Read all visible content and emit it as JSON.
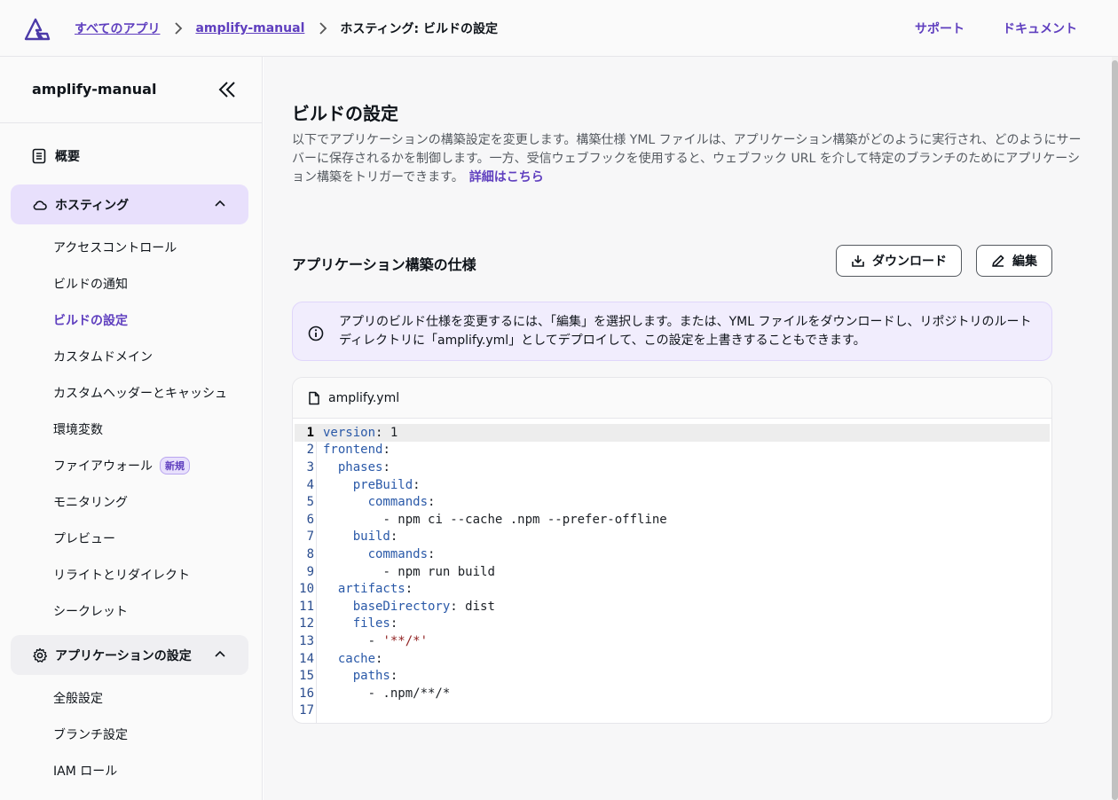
{
  "breadcrumb": {
    "all_apps": "すべてのアプリ",
    "app": "amplify-manual",
    "current": "ホスティング: ビルドの設定"
  },
  "toplinks": {
    "support": "サポート",
    "docs": "ドキュメント"
  },
  "sidebar": {
    "app_name": "amplify-manual",
    "overview": "概要",
    "hosting": {
      "label": "ホスティング",
      "items": [
        "アクセスコントロール",
        "ビルドの通知",
        "ビルドの設定",
        "カスタムドメイン",
        "カスタムヘッダーとキャッシュ",
        "環境変数",
        "ファイアウォール",
        "モニタリング",
        "プレビュー",
        "リライトとリダイレクト",
        "シークレット"
      ],
      "firewall_badge": "新規"
    },
    "app_settings": {
      "label": "アプリケーションの設定",
      "items": [
        "全般設定",
        "ブランチ設定",
        "IAM ロール"
      ]
    }
  },
  "main": {
    "title": "ビルドの設定",
    "description": "以下でアプリケーションの構築設定を変更します。構築仕様 YML ファイルは、アプリケーション構築がどのように実行され、どのようにサーバーに保存されるかを制御します。一方、受信ウェブフックを使用すると、ウェブフック URL を介して特定のブランチのためにアプリケーション構築をトリガーできます。",
    "learn_more": "詳細はこちら",
    "spec_title": "アプリケーション構築の仕様",
    "download_label": "ダウンロード",
    "edit_label": "編集",
    "info_text": "アプリのビルド仕様を変更するには、「編集」を選択します。または、YML ファイルをダウンロードし、リポジトリのルートディレクトリに「amplify.yml」としてデプロイして、この設定を上書きすることもできます。",
    "file_name": "amplify.yml"
  },
  "code": [
    {
      "n": "1",
      "indent": "",
      "key": "version",
      "rest": ": 1"
    },
    {
      "n": "2",
      "indent": "",
      "key": "frontend",
      "rest": ":"
    },
    {
      "n": "3",
      "indent": "  ",
      "key": "phases",
      "rest": ":"
    },
    {
      "n": "4",
      "indent": "    ",
      "key": "preBuild",
      "rest": ":"
    },
    {
      "n": "5",
      "indent": "      ",
      "key": "commands",
      "rest": ":"
    },
    {
      "n": "6",
      "indent": "        ",
      "key": "",
      "rest": "- npm ci --cache .npm --prefer-offline"
    },
    {
      "n": "7",
      "indent": "    ",
      "key": "build",
      "rest": ":"
    },
    {
      "n": "8",
      "indent": "      ",
      "key": "commands",
      "rest": ":"
    },
    {
      "n": "9",
      "indent": "        ",
      "key": "",
      "rest": "- npm run build"
    },
    {
      "n": "10",
      "indent": "  ",
      "key": "artifacts",
      "rest": ":"
    },
    {
      "n": "11",
      "indent": "    ",
      "key": "baseDirectory",
      "rest": ": dist"
    },
    {
      "n": "12",
      "indent": "    ",
      "key": "files",
      "rest": ":"
    },
    {
      "n": "13",
      "indent": "      ",
      "key": "",
      "rest": "- ",
      "str": "'**/*'"
    },
    {
      "n": "14",
      "indent": "  ",
      "key": "cache",
      "rest": ":"
    },
    {
      "n": "15",
      "indent": "    ",
      "key": "paths",
      "rest": ":"
    },
    {
      "n": "16",
      "indent": "      ",
      "key": "",
      "rest": "- .npm/**/*"
    },
    {
      "n": "17",
      "indent": "",
      "key": "",
      "rest": ""
    }
  ],
  "colors": {
    "accent": "#5f3fbf",
    "accent_bg": "#e8e0fc"
  }
}
